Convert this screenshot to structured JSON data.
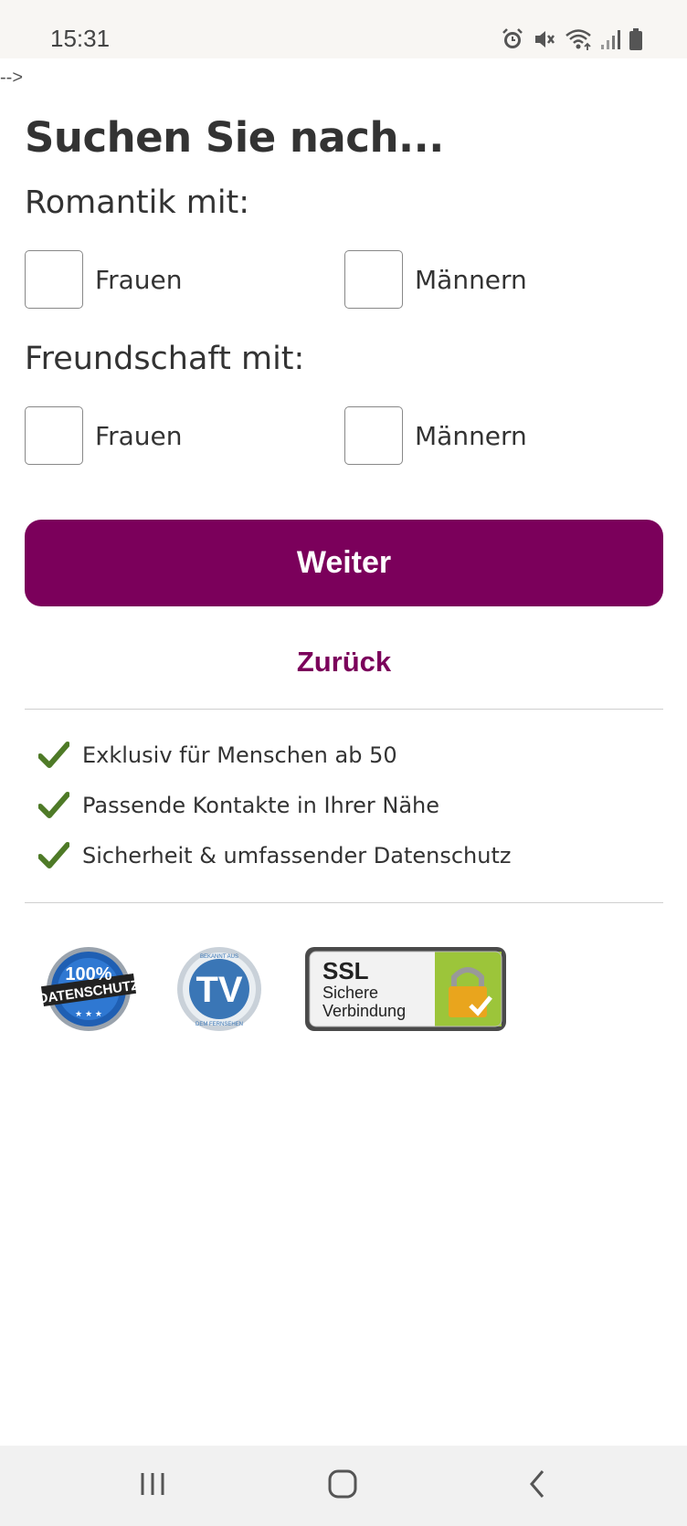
{
  "status_bar": {
    "time": "15:31",
    "icons": [
      "alarm-icon",
      "mute-icon",
      "wifi-icon",
      "signal-icon",
      "battery-icon"
    ]
  },
  "stray_text": "-->",
  "form": {
    "title": "Suchen Sie nach...",
    "groups": [
      {
        "label": "Romantik mit:",
        "options": [
          {
            "label": "Frauen",
            "checked": false
          },
          {
            "label": "Männern",
            "checked": false
          }
        ]
      },
      {
        "label": "Freundschaft mit:",
        "options": [
          {
            "label": "Frauen",
            "checked": false
          },
          {
            "label": "Männern",
            "checked": false
          }
        ]
      }
    ],
    "continue_label": "Weiter",
    "back_label": "Zurück"
  },
  "features": [
    "Exklusiv für Menschen ab 50",
    "Passende Kontakte in Ihrer Nähe",
    "Sicherheit & umfassender Datenschutz"
  ],
  "badges": {
    "privacy": {
      "top": "100%",
      "bottom": "DATENSCHUTZ"
    },
    "tv": {
      "main": "TV",
      "ring_top": "BEKANNT AUS",
      "ring_bottom": "DEM FERNSEHEN"
    },
    "ssl": {
      "line1": "SSL",
      "line2": "Sichere",
      "line3": "Verbindung"
    }
  },
  "colors": {
    "brand": "#7b005b",
    "check": "#4e7a27",
    "text": "#333333",
    "divider": "#cfcfcf"
  },
  "nav_bar": [
    "recent-apps-icon",
    "home-icon",
    "back-icon"
  ]
}
